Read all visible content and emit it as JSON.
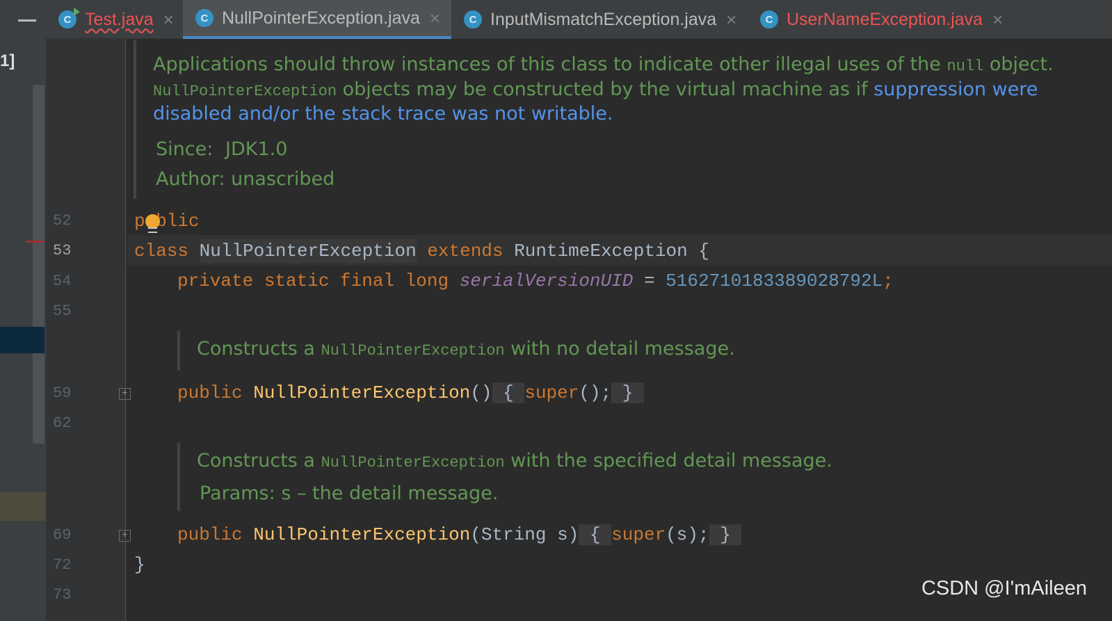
{
  "left_strip": {
    "label": "1]"
  },
  "tabs": [
    {
      "label": "Test.java",
      "icon": "C",
      "close": "×"
    },
    {
      "label": "NullPointerException.java",
      "icon": "C",
      "close": "×"
    },
    {
      "label": "InputMismatchException.java",
      "icon": "C",
      "close": "×"
    },
    {
      "label": "UserNameException.java",
      "icon": "C",
      "close": "×"
    }
  ],
  "doc1": {
    "line1": "Applications should throw instances of this class to indicate other illegal uses of the",
    "line1_code": "null",
    "line1_end": " object.",
    "line2_code": "NullPointerException",
    "line2_text": " objects may be constructed by the virtual machine as if ",
    "line2_link": "suppression were",
    "line3_link": "disabled and/or the stack trace was not writable.",
    "since_label": "Since:",
    "since_value": "JDK1.0",
    "author_label": "Author:",
    "author_value": "unascribed"
  },
  "lines": {
    "n52": "52",
    "n53": "53",
    "n54": "54",
    "n55": "55",
    "n59": "59",
    "n62": "62",
    "n69": "69",
    "n72": "72",
    "n73": "73"
  },
  "code": {
    "public_kw": "public",
    "class_kw": "class",
    "class_name": "NullPointerException",
    "extends_kw": "extends",
    "super_class": "RuntimeException",
    "open_brace": "{",
    "field_mods": "private static final long",
    "field_name": "serialVersionUID",
    "equals": "=",
    "field_value": "5162710183389028792L",
    "semicolon": ";",
    "ctor1_mod": "public",
    "ctor1_name": "NullPointerException",
    "ctor1_params": "()",
    "ctor1_body_open": "{",
    "ctor1_super": "super",
    "ctor1_super_args": "();",
    "ctor1_body_close": "}",
    "ctor2_mod": "public",
    "ctor2_name": "NullPointerException",
    "ctor2_params": "(String s)",
    "ctor2_body_open": "{",
    "ctor2_super": "super",
    "ctor2_super_args": "(s);",
    "ctor2_body_close": "}",
    "close_brace": "}"
  },
  "doc2": {
    "pre": "Constructs a ",
    "code": "NullPointerException",
    "post": " with no detail message."
  },
  "doc3": {
    "pre": "Constructs a ",
    "code": "NullPointerException",
    "post": " with the specified detail message.",
    "params_label": "Params:",
    "params_value": "s – the detail message."
  },
  "fold_icon": "+",
  "watermark": "CSDN @I'mAileen",
  "colors": {
    "keyword": "#cc7832",
    "function": "#ffc66d",
    "field": "#9876aa",
    "number": "#6897bb",
    "doc_text": "#629755",
    "doc_link": "#5394ec",
    "tab_error": "#ed5353",
    "tab_accent": "#4a88c7"
  }
}
